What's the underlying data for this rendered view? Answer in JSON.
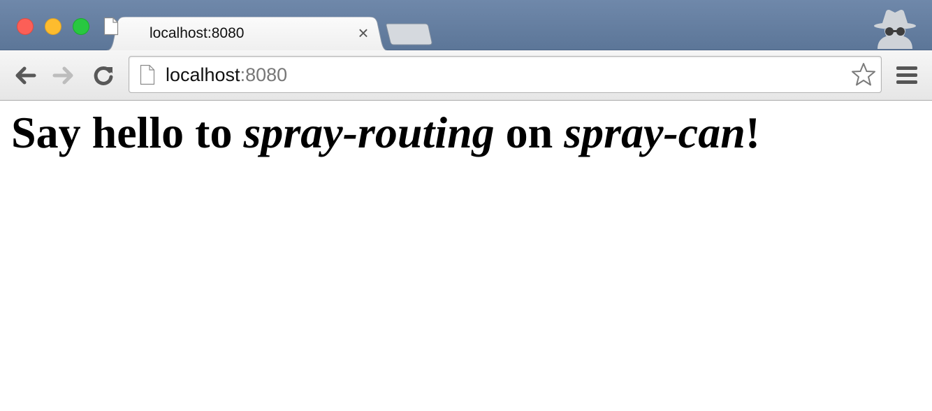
{
  "window": {
    "traffic_lights": {
      "close": "#fc5f57",
      "minimize": "#fdbc2e",
      "zoom": "#28c840"
    },
    "titlebar_color": "#5c7698"
  },
  "tab": {
    "title": "localhost:8080",
    "close_label": "×",
    "icon": "page-icon"
  },
  "toolbar": {
    "back_icon": "back-arrow-icon",
    "forward_icon": "forward-arrow-icon",
    "reload_icon": "reload-icon",
    "menu_icon": "hamburger-menu-icon",
    "incognito_icon": "incognito-icon"
  },
  "omnibox": {
    "host": "localhost",
    "port": ":8080",
    "icon": "page-icon",
    "bookmark_icon": "star-icon"
  },
  "page": {
    "heading": {
      "part1": "Say hello to ",
      "em1": "spray-routing",
      "part2": " on ",
      "em2": "spray-can",
      "part3": "!"
    }
  }
}
